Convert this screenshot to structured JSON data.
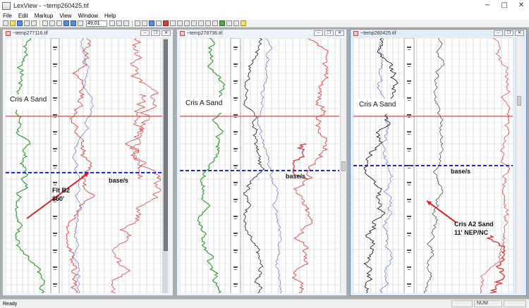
{
  "app": {
    "title": "LexView - ~temp260425.tif"
  },
  "window_controls": {
    "minimize": "−",
    "maximize": "□",
    "close": "✕"
  },
  "menu": [
    "File",
    "Edit",
    "Markup",
    "View",
    "Window",
    "Help"
  ],
  "toolbar": {
    "zoom_value": "49.01"
  },
  "documents": [
    {
      "title": "~temp277116.tif",
      "sand_label": "Cris A Sand",
      "base_label": "base/s",
      "annotation": [
        "Flt B2",
        "850'"
      ]
    },
    {
      "title": "~temp278736.tif",
      "sand_label": "Cris A Sand",
      "base_label": "base/s"
    },
    {
      "title": "~temp260425.tif",
      "sand_label": "Cris A Sand",
      "base_label": "base/s",
      "annotation": [
        "Cris A2 Sand",
        "11' NEP/NC"
      ]
    }
  ],
  "doc_controls": {
    "minimize": "–",
    "restore": "❐",
    "close": "✕"
  },
  "colors": {
    "sand_line": "#e02020",
    "base_line": "#1a2be0",
    "arrow": "#e02020",
    "log_green": "#2a9a2a",
    "log_red": "#e03030",
    "log_black": "#202020",
    "log_blue": "#4a5ccc",
    "grid": "#b8b8b8"
  },
  "status": {
    "text": "Ready",
    "cell1": "",
    "cell2": "NUM",
    "cell3": ""
  }
}
